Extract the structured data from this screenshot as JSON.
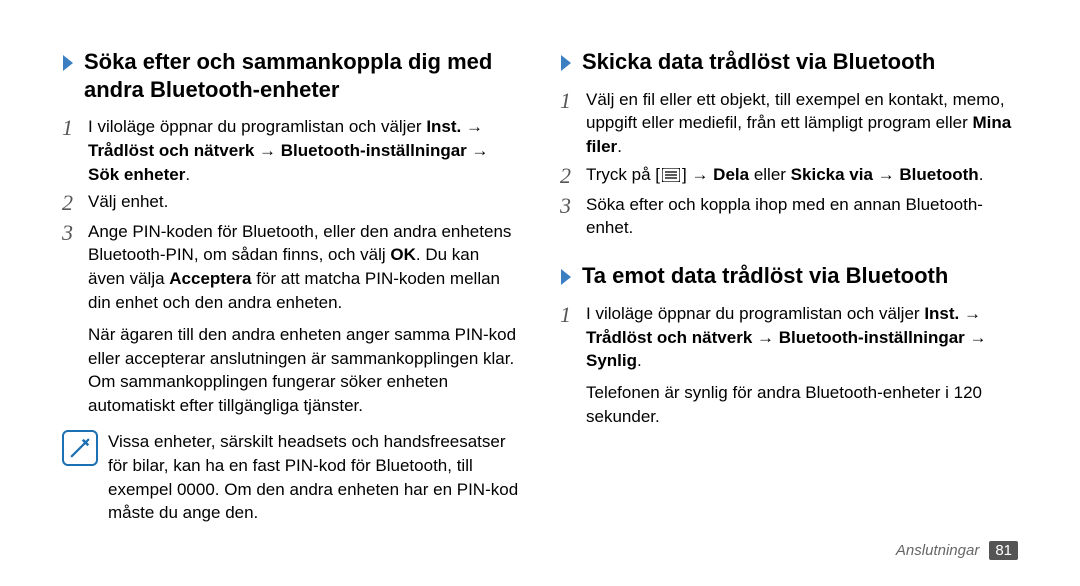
{
  "left": {
    "title": "Söka efter och sammankoppla dig med andra Bluetooth-enheter",
    "step1_a": "I viloläge öppnar du programlistan och väljer ",
    "step1_inst": "Inst.",
    "step1_arrow": " → ",
    "step1_b": "Trådlöst och nätverk",
    "step1_c": "Bluetooth-inställningar",
    "step1_d": "Sök enheter",
    "step1_dot": ".",
    "step2": "Välj enhet.",
    "step3_a": "Ange PIN-koden för Bluetooth, eller den andra enhetens Bluetooth-PIN, om sådan finns, och välj ",
    "step3_ok": "OK",
    "step3_b": ". Du kan även välja ",
    "step3_acc": "Acceptera",
    "step3_c": " för att matcha PIN-koden mellan din enhet och den andra enheten.",
    "step3_extra": "När ägaren till den andra enheten anger samma PIN-kod eller accepterar anslutningen är sammankopplingen klar. Om sammankopplingen fungerar söker enheten automatiskt efter tillgängliga tjänster.",
    "note": "Vissa enheter, särskilt headsets och handsfreesatser för bilar, kan ha en fast PIN-kod för Bluetooth, till exempel 0000. Om den andra enheten har en PIN-kod måste du ange den."
  },
  "right": {
    "send_title": "Skicka data trådlöst via Bluetooth",
    "send1_a": "Välj en fil eller ett objekt, till exempel en kontakt, memo, uppgift eller mediefil, från ett lämpligt program eller ",
    "send1_mina": "Mina filer",
    "send1_dot": ".",
    "send2_a": "Tryck på [",
    "send2_b": "] → ",
    "send2_dela": "Dela",
    "send2_eller": " eller ",
    "send2_skicka": "Skicka via",
    "send2_arrow": " → ",
    "send2_bt": "Bluetooth",
    "send2_dot": ".",
    "send3": "Söka efter och koppla ihop med en annan Bluetooth-enhet.",
    "recv_title": "Ta emot data trådlöst via Bluetooth",
    "recv1_a": "I viloläge öppnar du programlistan och väljer ",
    "recv1_inst": "Inst.",
    "recv1_arrow": " → ",
    "recv1_b": "Trådlöst och nätverk",
    "recv1_c": "Bluetooth-inställningar",
    "recv1_d": "Synlig",
    "recv1_dot": ".",
    "recv1_extra": "Telefonen är synlig för andra Bluetooth-enheter i 120 sekunder."
  },
  "footer": {
    "label": "Anslutningar",
    "page": "81"
  }
}
